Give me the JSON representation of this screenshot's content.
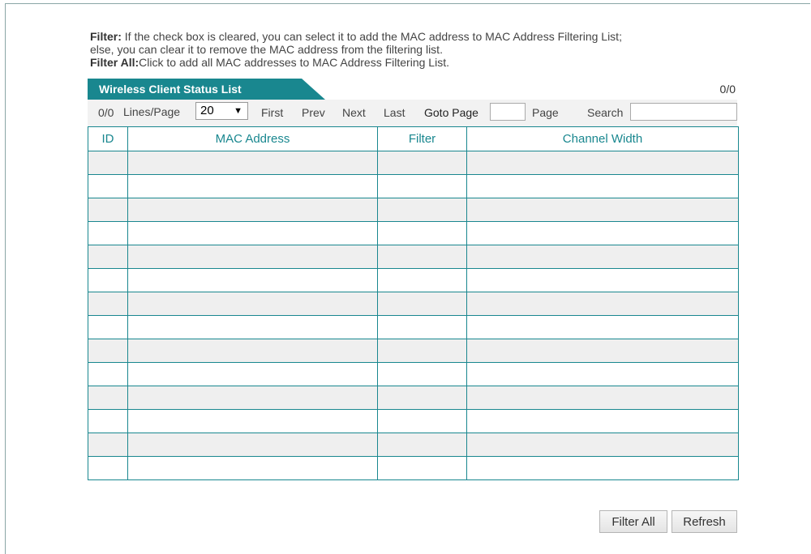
{
  "help": {
    "filter_label": "Filter:",
    "filter_text_1": " If the check box is cleared, you can select it to add the MAC address to MAC Address Filtering List;",
    "filter_text_2": "else, you can clear it to remove the MAC address from the filtering list.",
    "filter_all_label": "Filter All:",
    "filter_all_text": "Click to add all MAC addresses to MAC Address Filtering List."
  },
  "list": {
    "title": "Wireless Client Status List",
    "count": "0/0"
  },
  "toolbar": {
    "count": "0/0",
    "lines_per_page_label": "Lines/Page",
    "lines_per_page_value": "20",
    "first": "First",
    "prev": "Prev",
    "next": "Next",
    "last": "Last",
    "goto_label": "Goto Page",
    "goto_value": "",
    "page_label": "Page",
    "search_label": "Search",
    "search_value": ""
  },
  "table": {
    "columns": [
      "ID",
      "MAC Address",
      "Filter",
      "Channel Width"
    ],
    "rows": [
      [
        "",
        "",
        "",
        ""
      ],
      [
        "",
        "",
        "",
        ""
      ],
      [
        "",
        "",
        "",
        ""
      ],
      [
        "",
        "",
        "",
        ""
      ],
      [
        "",
        "",
        "",
        ""
      ],
      [
        "",
        "",
        "",
        ""
      ],
      [
        "",
        "",
        "",
        ""
      ],
      [
        "",
        "",
        "",
        ""
      ],
      [
        "",
        "",
        "",
        ""
      ],
      [
        "",
        "",
        "",
        ""
      ],
      [
        "",
        "",
        "",
        ""
      ],
      [
        "",
        "",
        "",
        ""
      ],
      [
        "",
        "",
        "",
        ""
      ],
      [
        "",
        "",
        "",
        ""
      ]
    ]
  },
  "buttons": {
    "filter_all": "Filter All",
    "refresh": "Refresh"
  },
  "colors": {
    "accent": "#19878f",
    "row_shade": "#efefef"
  }
}
